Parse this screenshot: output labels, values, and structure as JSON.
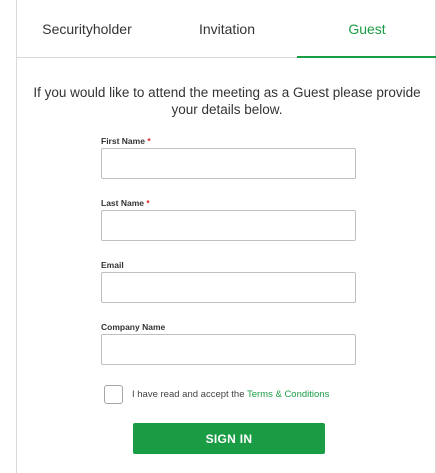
{
  "tabs": [
    {
      "label": "Securityholder",
      "active": false
    },
    {
      "label": "Invitation",
      "active": false
    },
    {
      "label": "Guest",
      "active": true
    }
  ],
  "intro_text": "If you would like to attend the meeting as a Guest please provide your details below.",
  "form": {
    "first_name": {
      "label": "First Name",
      "required_mark": "*",
      "value": ""
    },
    "last_name": {
      "label": "Last Name",
      "required_mark": "*",
      "value": ""
    },
    "email": {
      "label": "Email",
      "value": ""
    },
    "company_name": {
      "label": "Company Name",
      "value": ""
    }
  },
  "terms": {
    "checked": false,
    "text": "I have read and accept the",
    "link_text": "Terms & Conditions"
  },
  "submit_label": "SIGN IN",
  "colors": {
    "accent": "#1a9c45",
    "required": "#d9262b",
    "border": "#d9d9d9"
  }
}
